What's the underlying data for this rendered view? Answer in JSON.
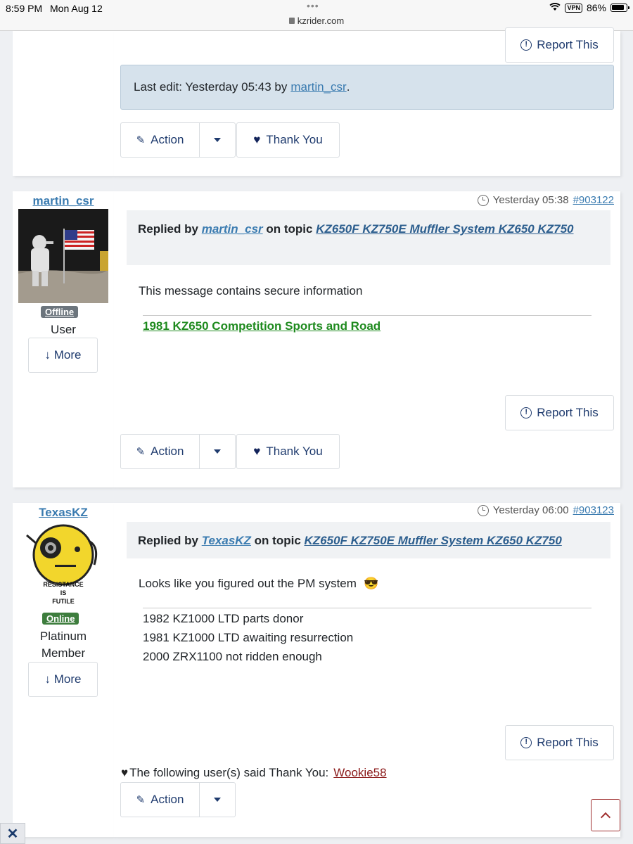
{
  "statusbar": {
    "time": "8:59 PM",
    "date": "Mon Aug 12",
    "url": "kzrider.com",
    "vpn": "VPN",
    "battery": "86%"
  },
  "top_post": {
    "report_label": "Report This",
    "last_edit_prefix": "Last edit: Yesterday 05:43 by",
    "last_edit_user": "martin_csr",
    "action_label": "Action",
    "thank_label": "Thank You"
  },
  "post1": {
    "username": "martin_csr",
    "status": "Offline",
    "rank": "User",
    "more_label": "↓ More",
    "time": "Yesterday 05:38",
    "post_id": "#903122",
    "replied_by": "Replied by",
    "on_topic": "on topic",
    "topic": "KZ650F KZ750E Muffler System KZ650 KZ750",
    "message": "This message contains secure information",
    "signature": "1981 KZ650 Competition Sports and Road",
    "report_label": "Report This",
    "action_label": "Action",
    "thank_label": "Thank You"
  },
  "post2": {
    "username": "TexasKZ",
    "avatar_text": [
      "RESISTANCE",
      "IS",
      "FUTILE"
    ],
    "status": "Online",
    "rank_line1": "Platinum",
    "rank_line2": "Member",
    "more_label": "↓ More",
    "time": "Yesterday 06:00",
    "post_id": "#903123",
    "replied_by": "Replied by",
    "on_topic": "on topic",
    "topic": "KZ650F KZ750E Muffler System KZ650 KZ750",
    "message": "Looks like you figured out the PM system",
    "emoji": "😎",
    "signature_lines": [
      "1982 KZ1000 LTD parts donor",
      "1981 KZ1000 LTD awaiting resurrection",
      "2000 ZRX1100 not ridden enough"
    ],
    "report_label": "Report This",
    "thanks_prefix": "The following user(s) said Thank You:",
    "thanks_user": "Wookie58",
    "action_label": "Action"
  },
  "colors": {
    "link": "#3a7bb0",
    "signature_green": "#1e8a1e",
    "offline": "#6c757d",
    "online": "#3d7d3d",
    "thanks_user": "#8b1a1a"
  }
}
